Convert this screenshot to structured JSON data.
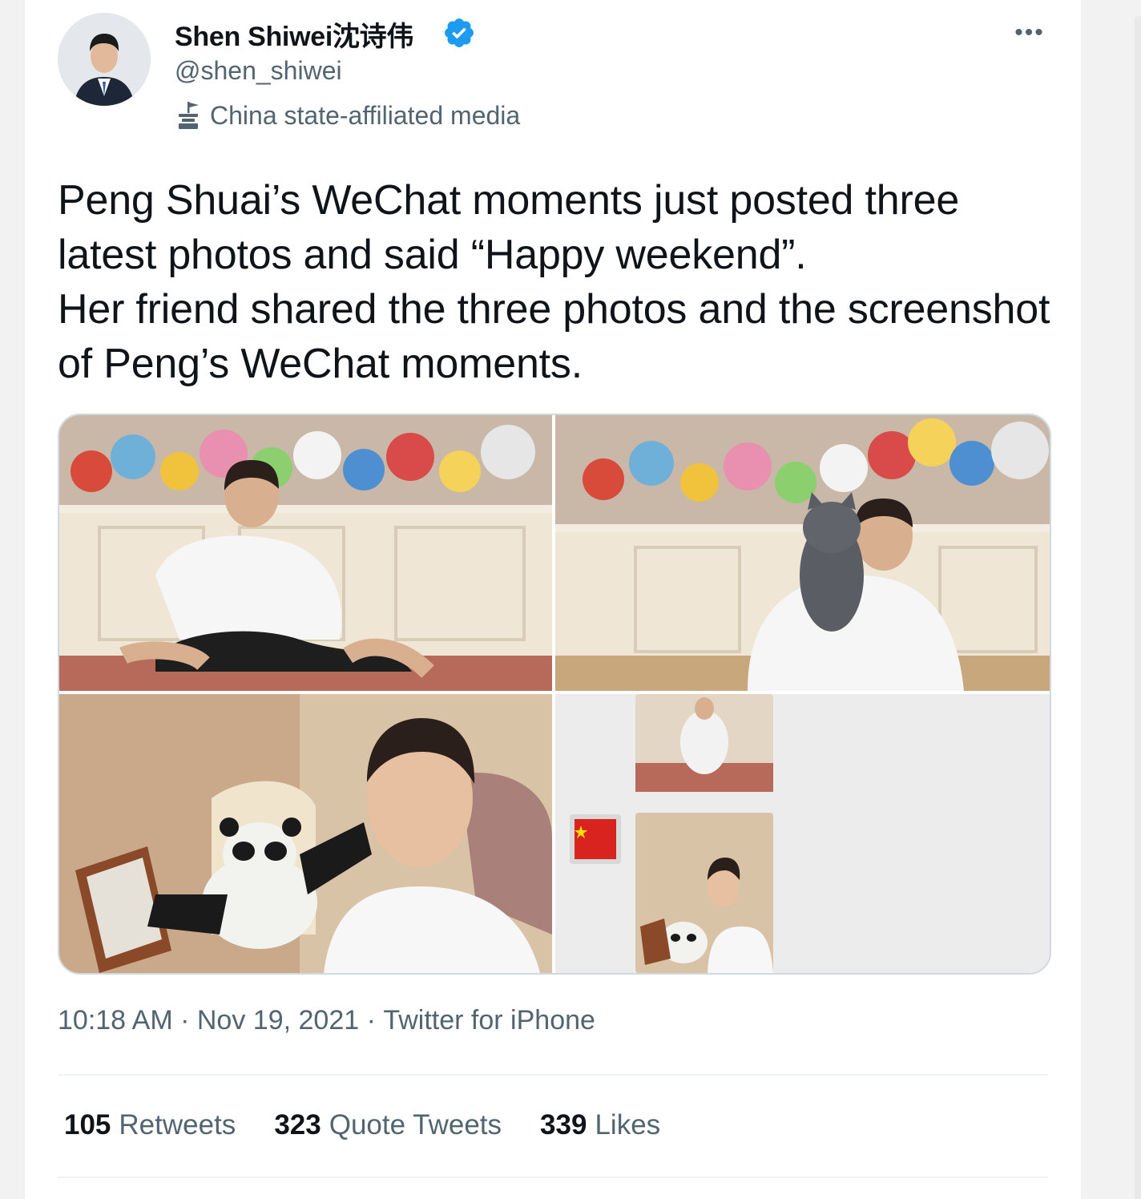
{
  "author": {
    "name": "Shen Shiwei沈诗伟",
    "handle": "@shen_shiwei",
    "label": "China state-affiliated media",
    "verified": true
  },
  "more_icon": "more-options-icon",
  "tweet": {
    "lines": [
      "Peng Shuai’s WeChat moments just posted three latest photos and said “Happy weekend”.",
      "Her friend shared the three photos and the screenshot of Peng’s WeChat moments."
    ]
  },
  "media": [
    {
      "name": "photo-sitting-cross-legged"
    },
    {
      "name": "photo-holding-cat"
    },
    {
      "name": "photo-selfie-with-panda"
    },
    {
      "name": "photo-wechat-moments-screenshot"
    }
  ],
  "meta": {
    "time": "10:18 AM",
    "sep": " · ",
    "date": "Nov 19, 2021",
    "source": "Twitter for iPhone"
  },
  "stats": {
    "retweets_count": "105",
    "retweets_label": "Retweets",
    "quotes_count": "323",
    "quotes_label": "Quote Tweets",
    "likes_count": "339",
    "likes_label": "Likes"
  },
  "colors": {
    "text_primary": "#0f1419",
    "text_secondary": "#536471",
    "verified_blue": "#1d9bf0",
    "border": "#cfd9de"
  }
}
